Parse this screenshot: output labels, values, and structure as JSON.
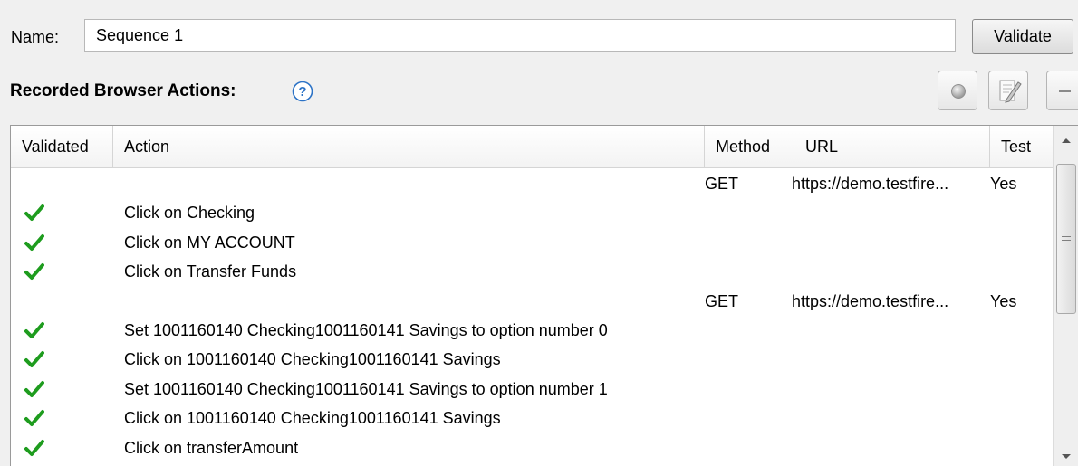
{
  "form": {
    "name_label": "Name:",
    "name_value": "Sequence 1",
    "validate_first": "V",
    "validate_rest": "alidate"
  },
  "recorded": {
    "title": "Recorded Browser Actions:"
  },
  "icons": {
    "help": "help-icon",
    "record": "record-icon",
    "edit": "edit-icon",
    "remove": "minus-icon",
    "validated": "checkmark-icon"
  },
  "colors": {
    "checkmark": "#1e9c1e",
    "help_icon": "#2b72c6"
  },
  "table": {
    "columns": [
      "Validated",
      "Action",
      "Method",
      "URL",
      "Test"
    ],
    "rows": [
      {
        "validated": false,
        "action": "",
        "method": "GET",
        "url": "https://demo.testfire...",
        "test": "Yes"
      },
      {
        "validated": true,
        "action": "Click on Checking",
        "method": "",
        "url": "",
        "test": ""
      },
      {
        "validated": true,
        "action": "Click on MY ACCOUNT",
        "method": "",
        "url": "",
        "test": ""
      },
      {
        "validated": true,
        "action": "Click on Transfer Funds",
        "method": "",
        "url": "",
        "test": ""
      },
      {
        "validated": false,
        "action": "",
        "method": "GET",
        "url": "https://demo.testfire...",
        "test": "Yes"
      },
      {
        "validated": true,
        "action": "Set 1001160140 Checking1001160141 Savings to option number 0",
        "method": "",
        "url": "",
        "test": ""
      },
      {
        "validated": true,
        "action": "Click on 1001160140 Checking1001160141 Savings",
        "method": "",
        "url": "",
        "test": ""
      },
      {
        "validated": true,
        "action": "Set 1001160140 Checking1001160141 Savings to option number 1",
        "method": "",
        "url": "",
        "test": ""
      },
      {
        "validated": true,
        "action": "Click on 1001160140 Checking1001160141 Savings",
        "method": "",
        "url": "",
        "test": ""
      },
      {
        "validated": true,
        "action": "Click on transferAmount",
        "method": "",
        "url": "",
        "test": ""
      }
    ]
  }
}
